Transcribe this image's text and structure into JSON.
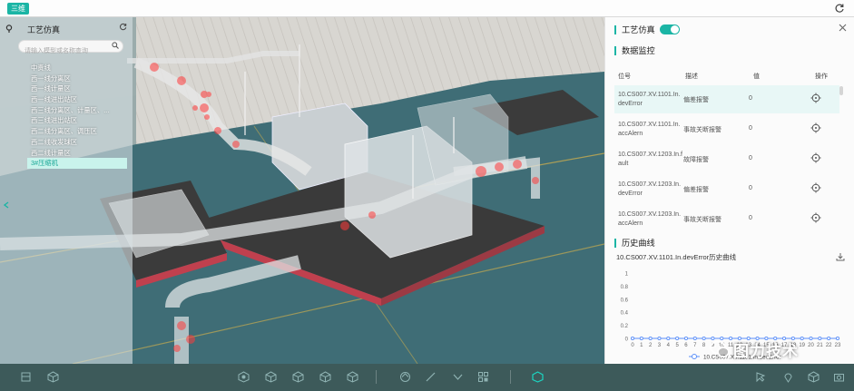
{
  "topbar": {
    "view_button": "三维"
  },
  "tree": {
    "title": "工艺仿真",
    "search_placeholder": "请输入模型或名称查询",
    "items": [
      {
        "label": "中贵线",
        "active": false
      },
      {
        "label": "西一线分离区",
        "active": false
      },
      {
        "label": "西一线计量区",
        "active": false
      },
      {
        "label": "西一线进出站区",
        "active": false
      },
      {
        "label": "西三线分离区、计量区、...",
        "active": false
      },
      {
        "label": "西三线进出站区",
        "active": false
      },
      {
        "label": "西二线分离区、调压区",
        "active": false
      },
      {
        "label": "西二线收发球区",
        "active": false
      },
      {
        "label": "西二线计量区",
        "active": false
      },
      {
        "label": "3#压缩机",
        "active": true
      }
    ]
  },
  "panel": {
    "sim_title": "工艺仿真",
    "sim_enabled": true,
    "monitor_title": "数据监控",
    "columns": {
      "tag": "位号",
      "desc": "描述",
      "value": "值",
      "op": "操作"
    },
    "rows": [
      {
        "tag": "10.CS007.XV.1101.In.devError",
        "desc": "偏差报警",
        "value": "0",
        "selected": true
      },
      {
        "tag": "10.CS007.XV.1101.In.accAlern",
        "desc": "事故关断报警",
        "value": "0",
        "selected": false
      },
      {
        "tag": "10.CS007.XV.1203.In.fault",
        "desc": "故障报警",
        "value": "0",
        "selected": false
      },
      {
        "tag": "10.CS007.XV.1203.In.devError",
        "desc": "偏差报警",
        "value": "0",
        "selected": false
      },
      {
        "tag": "10.CS007.XV.1203.In.accAlern",
        "desc": "事故关断报警",
        "value": "0",
        "selected": false
      }
    ],
    "history_title": "历史曲线",
    "chart_title": "10.CS007.XV.1101.In.devError历史曲线"
  },
  "chart_data": {
    "type": "line",
    "x": [
      0,
      1,
      2,
      3,
      4,
      5,
      6,
      7,
      8,
      9,
      10,
      11,
      12,
      13,
      14,
      15,
      16,
      17,
      18,
      19,
      20,
      21,
      22,
      23
    ],
    "series": [
      {
        "name": "10.CS007.XV.1101.In.devError",
        "values": [
          0,
          0,
          0,
          0,
          0,
          0,
          0,
          0,
          0,
          0,
          0,
          0,
          0,
          0,
          0,
          0,
          0,
          0,
          0,
          0,
          0,
          0,
          0,
          0
        ]
      }
    ],
    "yticks": [
      "0",
      "0.2",
      "0.4",
      "0.6",
      "0.8",
      "1"
    ],
    "ylim": [
      0,
      1
    ],
    "grid": false,
    "legend": "bottom",
    "color": "#5b8ff9"
  },
  "watermark": {
    "text": "图力技术"
  },
  "colors": {
    "accent": "#1bb5a5",
    "toolbar": "#3d5a5a"
  }
}
